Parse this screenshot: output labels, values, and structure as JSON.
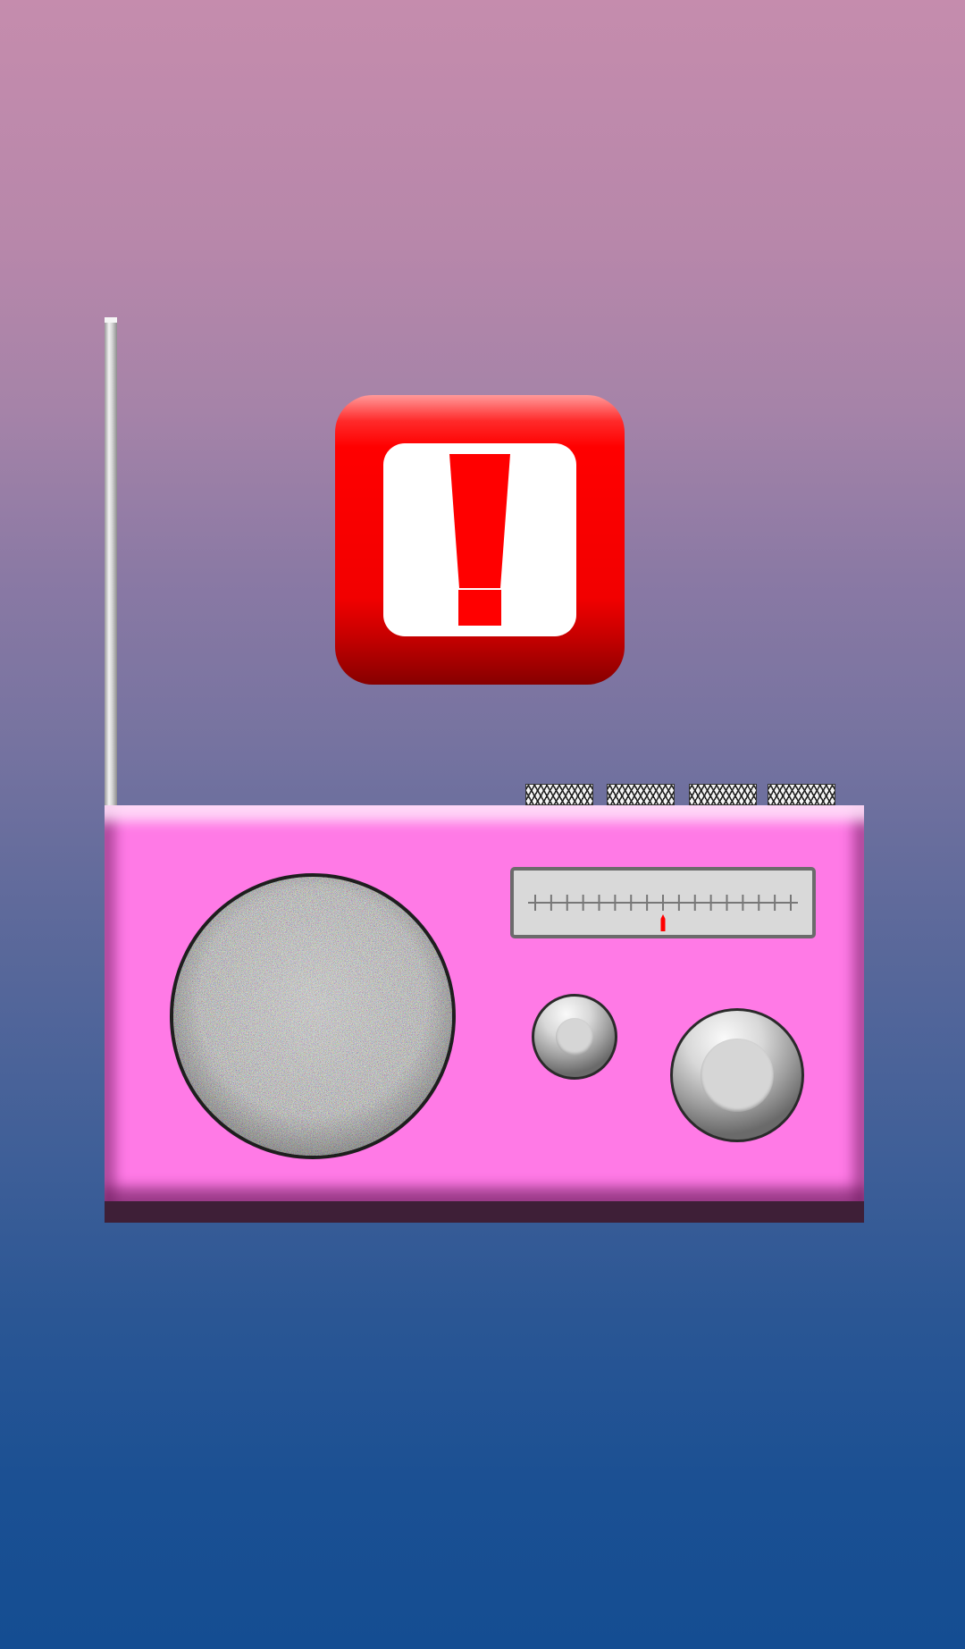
{
  "scene": {
    "background_top": "#c58cad",
    "background_bottom": "#144d92"
  },
  "alert": {
    "icon": "exclamation-mark-icon",
    "color": "#ff0000"
  },
  "radio": {
    "body_color": "#ff7ae6",
    "base_color": "#3e1f37",
    "antenna": "antenna-rod",
    "speaker": "static-noise-speaker",
    "grills": [
      "grill",
      "grill",
      "grill",
      "grill"
    ],
    "tuning_dial": {
      "needle_color": "#ff0000",
      "tick_count": 17,
      "needle_tick_index": 8
    },
    "knobs": [
      "volume-knob",
      "tuning-knob"
    ]
  }
}
